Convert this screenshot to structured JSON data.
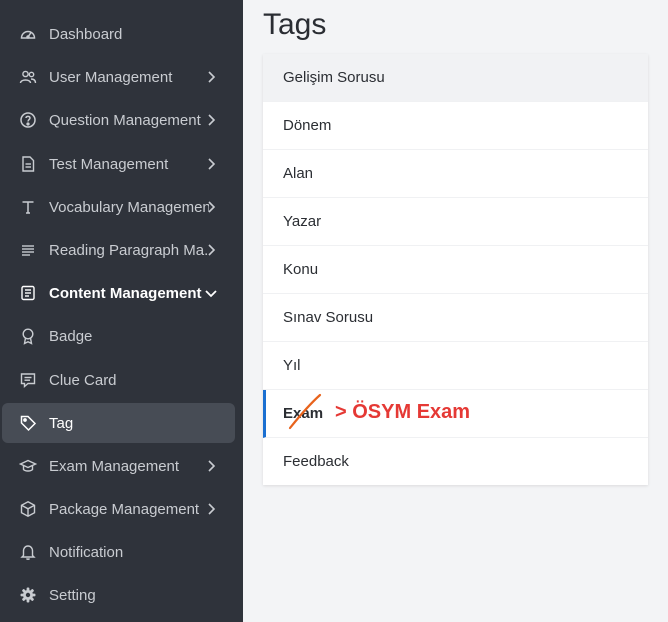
{
  "sidebar": {
    "items": [
      {
        "label": "Dashboard",
        "icon": "dashboard-icon",
        "has_chevron": false
      },
      {
        "label": "User Management",
        "icon": "users-icon",
        "has_chevron": true
      },
      {
        "label": "Question Management",
        "icon": "question-icon",
        "has_chevron": true
      },
      {
        "label": "Test Management",
        "icon": "document-icon",
        "has_chevron": true
      },
      {
        "label": "Vocabulary Management",
        "icon": "text-icon",
        "has_chevron": true
      },
      {
        "label": "Reading Paragraph Ma...",
        "icon": "paragraph-icon",
        "has_chevron": true
      },
      {
        "label": "Content Management",
        "icon": "content-icon",
        "has_chevron": true,
        "expanded": true
      },
      {
        "label": "Badge",
        "icon": "badge-icon",
        "has_chevron": false
      },
      {
        "label": "Clue Card",
        "icon": "card-icon",
        "has_chevron": false
      },
      {
        "label": "Tag",
        "icon": "tag-icon",
        "has_chevron": false,
        "active": true
      },
      {
        "label": "Exam Management",
        "icon": "graduation-icon",
        "has_chevron": true
      },
      {
        "label": "Package Management",
        "icon": "package-icon",
        "has_chevron": true
      },
      {
        "label": "Notification",
        "icon": "bell-icon",
        "has_chevron": false
      },
      {
        "label": "Setting",
        "icon": "gear-icon",
        "has_chevron": false
      }
    ]
  },
  "main": {
    "title": "Tags",
    "tags": [
      {
        "label": "Gelişim Sorusu"
      },
      {
        "label": "Dönem"
      },
      {
        "label": "Alan"
      },
      {
        "label": "Yazar"
      },
      {
        "label": "Konu"
      },
      {
        "label": "Sınav Sorusu"
      },
      {
        "label": "Yıl"
      },
      {
        "label": "Exam",
        "selected": true
      },
      {
        "label": "Feedback"
      }
    ],
    "annotation": "> ÖSYM Exam"
  },
  "colors": {
    "sidebar_bg": "#2f333b",
    "active_bg": "#474c55",
    "accent": "#1a6fd1",
    "annotation": "#e53935",
    "strike": "#e8631c"
  }
}
